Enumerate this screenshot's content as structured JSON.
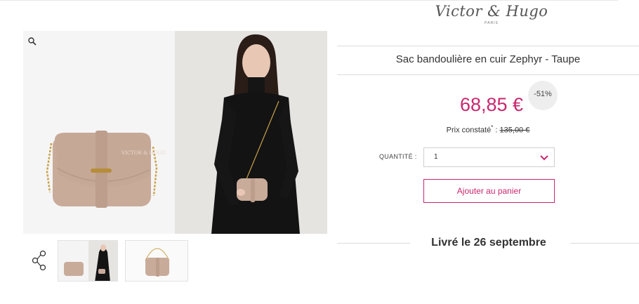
{
  "brand": {
    "logo_text": "Victor & Hugo",
    "logo_subtext": "PARIS"
  },
  "product": {
    "title": "Sac bandoulière en cuir Zephyr - Taupe",
    "price": "68,85 €",
    "discount_badge": "-51%",
    "reference_price_label": "Prix constaté",
    "reference_price_note": "*",
    "reference_price_sep": " : ",
    "reference_price": "135,00 €"
  },
  "quantity": {
    "label": "QUANTITÉ :",
    "selected": "1"
  },
  "actions": {
    "add_to_cart_label": "Ajouter au panier"
  },
  "delivery": {
    "text": "Livré le 26 septembre"
  },
  "gallery": {
    "main_images": [
      "bag-product-photo",
      "model-wearing-bag-photo"
    ],
    "thumbnails": [
      "thumb-bag-and-model",
      "thumb-bag-with-chain"
    ]
  },
  "colors": {
    "accent": "#c8286f",
    "bag": "#c9ab9a",
    "dress": "#111111"
  },
  "icons": {
    "zoom": "magnifier-icon",
    "share": "share-icon",
    "dropdown": "chevron-down-icon"
  }
}
